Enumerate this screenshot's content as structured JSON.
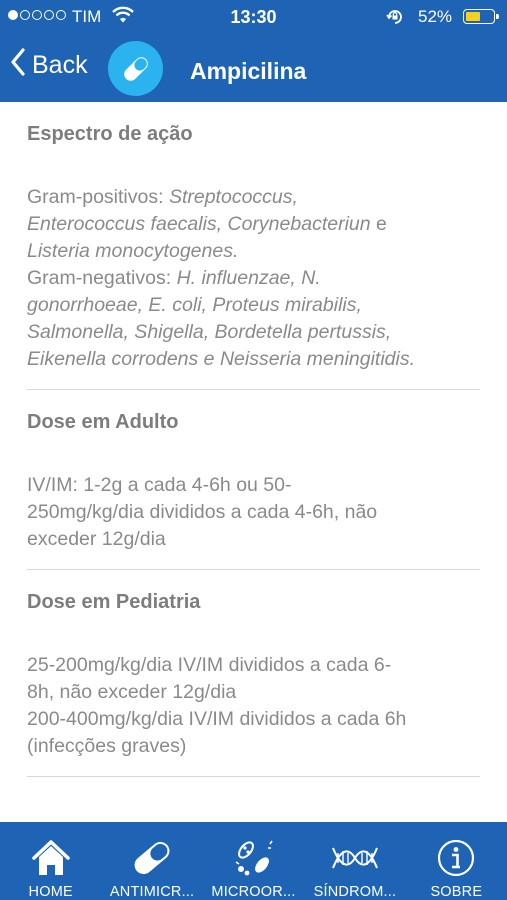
{
  "status_bar": {
    "carrier": "TIM",
    "time": "13:30",
    "battery_percent": "52%",
    "battery_level": 0.52,
    "icons": [
      "signal-icon",
      "wifi-icon",
      "rotation-lock-icon",
      "battery-icon"
    ]
  },
  "nav": {
    "back_label": "Back",
    "title": "Ampicilina",
    "logo_icon": "pill-icon"
  },
  "sections": [
    {
      "title": "Espectro de ação",
      "lines": [
        {
          "normal": "Gram-positivos: ",
          "italic": "Streptococcus,"
        },
        {
          "normal": "",
          "italic": "Enterococcus faecalis, Corynebacteriun",
          "after": " e"
        },
        {
          "normal": "",
          "italic": "Listeria monocytogenes."
        },
        {
          "normal": "Gram-negativos: ",
          "italic": "H. influenzae, N."
        },
        {
          "normal": "",
          "italic": "gonorrhoeae, E. coli, Proteus mirabilis,"
        },
        {
          "normal": "",
          "italic": "Salmonella, Shigella, Bordetella pertussis,"
        },
        {
          "normal": "",
          "italic": "Eikenella corrodens e Neisseria meningitidis."
        }
      ]
    },
    {
      "title": "Dose em Adulto",
      "lines": [
        "IV/IM: 1-2g a cada 4-6h ou 50-",
        "250mg/kg/dia divididos a cada 4-6h, não",
        "exceder 12g/dia"
      ]
    },
    {
      "title": "Dose em Pediatria",
      "lines": [
        "25-200mg/kg/dia IV/IM divididos a cada 6-",
        "8h, não exceder 12g/dia",
        "200-400mg/kg/dia IV/IM divididos a cada 6h",
        "(infecções graves)"
      ]
    }
  ],
  "tabs": [
    {
      "label": "HOME",
      "icon": "home-icon"
    },
    {
      "label": "ANTIMICR...",
      "icon": "pill-icon"
    },
    {
      "label": "MICROOR...",
      "icon": "microorganism-icon"
    },
    {
      "label": "SÍNDROM...",
      "icon": "dna-icon"
    },
    {
      "label": "SOBRE",
      "icon": "info-icon"
    }
  ],
  "colors": {
    "primary": "#1f64b4",
    "logo_bg": "#2bb3f0",
    "text_heading": "#7d7d7d",
    "text_body": "#8a8a8a",
    "battery_fill": "#f7d21c"
  }
}
